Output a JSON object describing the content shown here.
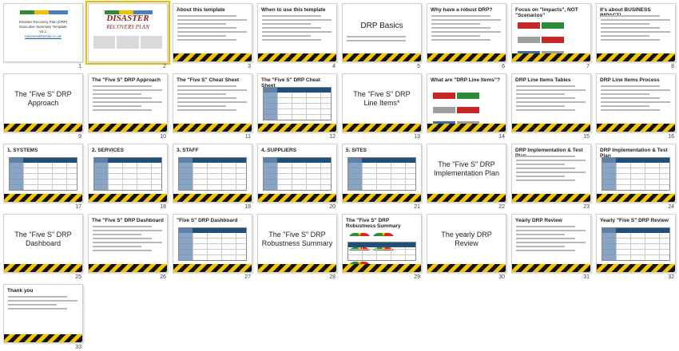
{
  "slides": [
    {
      "n": "1",
      "kind": "cover1",
      "title": "",
      "lines": [
        "Disaster Recovery Plan (DRP)",
        "Executive Summary Template",
        "v3.1",
        "businessbluestar.co.uk"
      ]
    },
    {
      "n": "2",
      "kind": "cover2",
      "title": "DISASTER",
      "subtitle": "RECOVERY PLAN",
      "selected": true
    },
    {
      "n": "3",
      "kind": "text",
      "title": "About this template"
    },
    {
      "n": "4",
      "kind": "text",
      "title": "When to use this template"
    },
    {
      "n": "5",
      "kind": "big",
      "title": "DRP Basics"
    },
    {
      "n": "6",
      "kind": "text",
      "title": "Why have a robust DRP?"
    },
    {
      "n": "7",
      "kind": "boxes",
      "title": "Focus on \"Impacts\", NOT \"Scenarios\""
    },
    {
      "n": "8",
      "kind": "text",
      "title": "It's about BUSINESS IMPACT!"
    },
    {
      "n": "9",
      "kind": "center",
      "title": "The \"Five S\" DRP Approach"
    },
    {
      "n": "10",
      "kind": "list",
      "title": "The \"Five S\" DRP Approach",
      "items": [
        "1. SYSTEMS",
        "2. SERVICES",
        "3. STAFF",
        "4. SUPPLIERS",
        "5. SITES"
      ]
    },
    {
      "n": "11",
      "kind": "text",
      "title": "The \"Five S\" Cheat Sheet"
    },
    {
      "n": "12",
      "kind": "table",
      "title": "The \"Five S\" DRP Cheat Sheet"
    },
    {
      "n": "13",
      "kind": "center",
      "title": "The \"Five S\" DRP Line Items*"
    },
    {
      "n": "14",
      "kind": "boxes",
      "title": "What are \"DRP Line Items\"?"
    },
    {
      "n": "15",
      "kind": "text",
      "title": "DRP Line Items Tables"
    },
    {
      "n": "16",
      "kind": "text",
      "title": "DRP Line Items Process"
    },
    {
      "n": "17",
      "kind": "table",
      "title": "1. SYSTEMS"
    },
    {
      "n": "18",
      "kind": "table",
      "title": "2. SERVICES"
    },
    {
      "n": "19",
      "kind": "table",
      "title": "3. STAFF"
    },
    {
      "n": "20",
      "kind": "table",
      "title": "4. SUPPLIERS"
    },
    {
      "n": "21",
      "kind": "table",
      "title": "5. SITES"
    },
    {
      "n": "22",
      "kind": "center",
      "title": "The \"Five S\" DRP Implementation Plan"
    },
    {
      "n": "23",
      "kind": "text",
      "title": "DRP Implementation & Test Plan"
    },
    {
      "n": "24",
      "kind": "table",
      "title": "DRP Implementation & Test Plan"
    },
    {
      "n": "25",
      "kind": "center",
      "title": "The \"Five S\" DRP Dashboard"
    },
    {
      "n": "26",
      "kind": "text",
      "title": "The \"Five S\" DRP Dashboard"
    },
    {
      "n": "27",
      "kind": "table",
      "title": "\"Five S\" DRP Dashboard"
    },
    {
      "n": "28",
      "kind": "center",
      "title": "The \"Five S\" DRP Robustness Summary"
    },
    {
      "n": "29",
      "kind": "gauges",
      "title": "The \"Five S\" DRP Robustness Summary"
    },
    {
      "n": "30",
      "kind": "center",
      "title": "The yearly DRP Review"
    },
    {
      "n": "31",
      "kind": "text",
      "title": "Yearly DRP Review"
    },
    {
      "n": "32",
      "kind": "table",
      "title": "Yearly \"Five S\" DRP Review"
    },
    {
      "n": "33",
      "kind": "thanks",
      "title": "Thank you"
    }
  ],
  "colors": {
    "stripe_dark": "#111111",
    "stripe_yellow": "#f5c400",
    "selection": "#f2b800",
    "table_head": "#1f4e79"
  }
}
